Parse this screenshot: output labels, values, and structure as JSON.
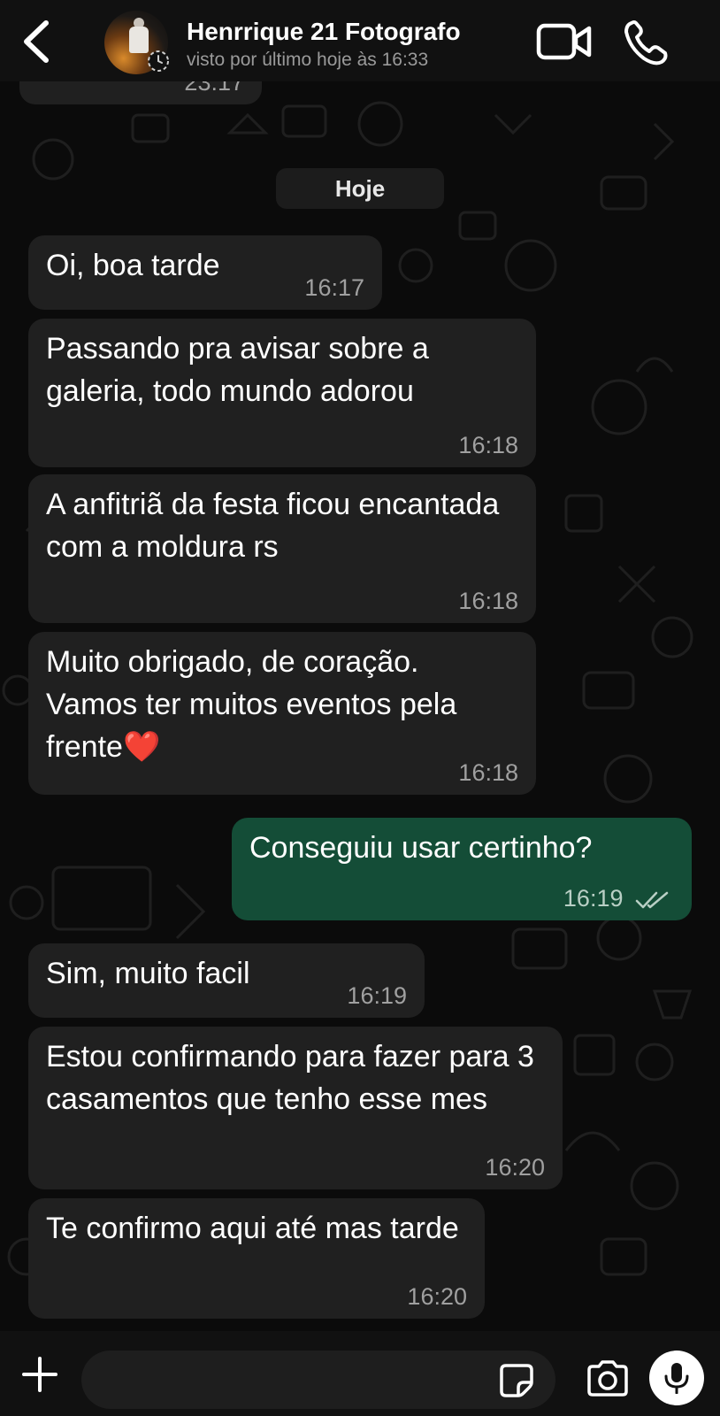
{
  "header": {
    "contact_name": "Henrrique 21 Fotografo",
    "last_seen": "visto por último hoje às 16:33"
  },
  "top_partial_time": "23:17",
  "date_chip": "Hoje",
  "messages": [
    {
      "direction": "in",
      "text": "Oi, boa tarde",
      "time": "16:17"
    },
    {
      "direction": "in",
      "text": "Passando pra avisar sobre a galeria, todo mundo adorou",
      "time": "16:18"
    },
    {
      "direction": "in",
      "text": "A anfitriã da festa ficou encantada com a moldura rs",
      "time": "16:18"
    },
    {
      "direction": "in",
      "text": "Muito obrigado, de coração. Vamos ter muitos eventos pela frente❤️",
      "time": "16:18"
    },
    {
      "direction": "out",
      "text": "Conseguiu usar certinho?",
      "time": "16:19",
      "status": "read"
    },
    {
      "direction": "in",
      "text": "Sim, muito facil",
      "time": "16:19"
    },
    {
      "direction": "in",
      "text": "Estou confirmando para fazer para 3 casamentos que tenho esse mes",
      "time": "16:20"
    },
    {
      "direction": "in",
      "text": "Te confirmo aqui até mas tarde",
      "time": "16:20"
    }
  ],
  "composer": {
    "placeholder": ""
  },
  "colors": {
    "background": "#0b0b0b",
    "incoming_bubble": "#202020",
    "outgoing_bubble": "#144d37",
    "header": "#111111"
  }
}
